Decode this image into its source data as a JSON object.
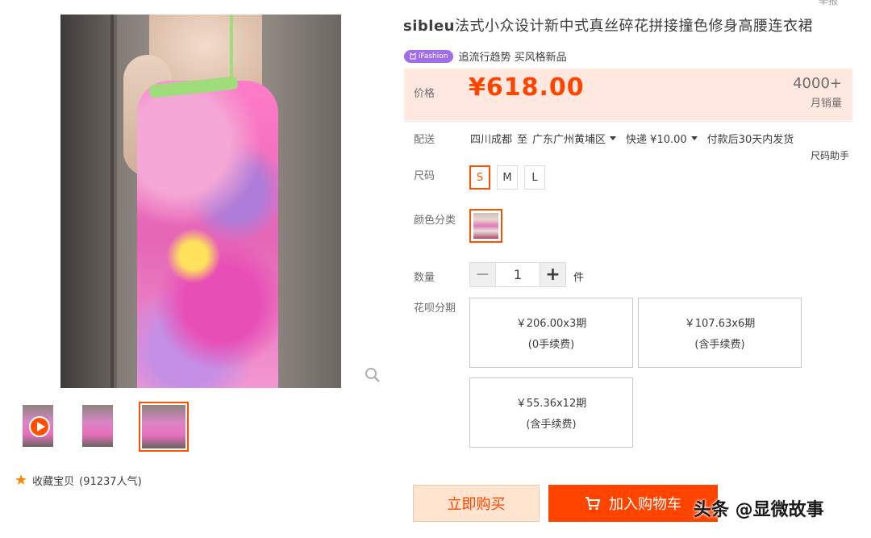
{
  "product": {
    "brand": "sibleu",
    "title": "法式小众设计新中式真丝碎花拼接撞色修身高腰连衣裙",
    "badge": "iFashion",
    "subtitle": "追流行趋势 买风格新品",
    "top_cut_text": "举报"
  },
  "price": {
    "label": "价格",
    "value": "¥618.00",
    "monthly_sales": "4000+",
    "monthly_sales_label": "月销量"
  },
  "shipping": {
    "label": "配送",
    "from": "四川成都",
    "to_word": "至",
    "to": "广东广州黄埔区",
    "method": "快递 ¥10.00",
    "delivery": "付款后30天内发货",
    "size_helper": "尺码助手"
  },
  "size": {
    "label": "尺码",
    "options": [
      "S",
      "M",
      "L"
    ],
    "selected": "S"
  },
  "color": {
    "label": "颜色分类"
  },
  "quantity": {
    "label": "数量",
    "minus": "−",
    "value": "1",
    "plus": "+",
    "unit": "件"
  },
  "installment": {
    "label": "花呗分期",
    "options": [
      {
        "amount": "￥206.00x3期",
        "fee": "(0手续费)"
      },
      {
        "amount": "￥107.63x6期",
        "fee": "(含手续费)"
      },
      {
        "amount": "￥55.36x12期",
        "fee": "(含手续费)"
      }
    ]
  },
  "actions": {
    "buy_now": "立即购买",
    "add_to_cart": "加入购物车"
  },
  "favorite": {
    "label": "收藏宝贝",
    "count": "(91237人气)"
  },
  "watermark": "头条 @显微故事",
  "colors": {
    "accent": "#ff4400",
    "selected_border": "#ff5000",
    "price_bg": "#ffe8e0",
    "badge": "#a06ee6"
  }
}
